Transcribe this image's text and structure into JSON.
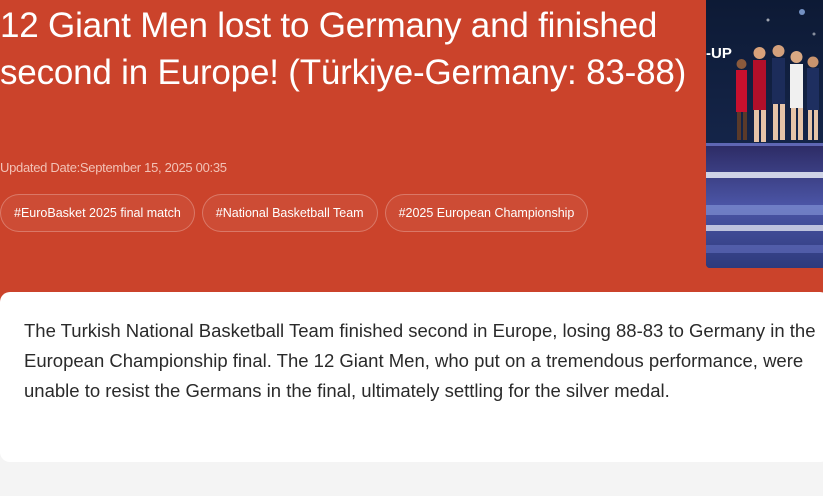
{
  "article": {
    "headline": "12 Giant Men lost to Germany and finished second in Europe! (Türkiye-Germany: 83-88)",
    "updated": "Updated Date:September 15, 2025 00:35",
    "tags": [
      "#EuroBasket 2025 final match",
      "#National Basketball Team",
      "#2025 European Championship"
    ],
    "photo_text": "-UP",
    "summary": "The Turkish National Basketball Team finished second in Europe, losing 88-83 to Germany in the European Championship final. The 12 Giant Men, who put on a tremendous performance, were unable to resist the Germans in the final, ultimately settling for the silver medal."
  },
  "colors": {
    "hero_bg": "#cb432b",
    "summary_bg": "#ffffff",
    "page_bg": "#f4f4f4"
  }
}
